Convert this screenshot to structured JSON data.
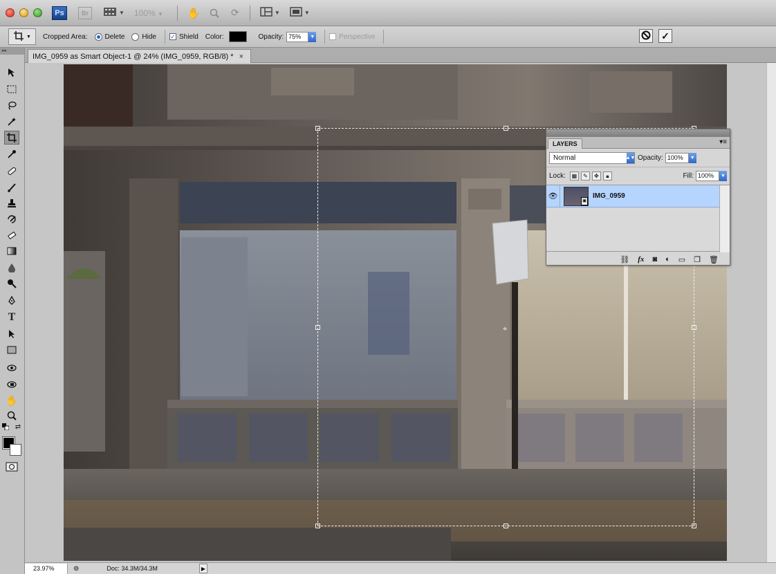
{
  "app": {
    "logo": "Ps",
    "bridge": "Br",
    "zoom": "100%"
  },
  "options": {
    "cropped_area_label": "Cropped Area:",
    "delete_label": "Delete",
    "hide_label": "Hide",
    "shield_label": "Shield",
    "color_label": "Color:",
    "opacity_label": "Opacity:",
    "opacity_value": "75%",
    "perspective_label": "Perspective",
    "shield_color": "#000000"
  },
  "document": {
    "tab_title": "IMG_0959 as Smart Object-1 @ 24% (IMG_0959, RGB/8) *",
    "close": "×"
  },
  "layers_panel": {
    "tab_label": "LAYERS",
    "blend_mode": "Normal",
    "opacity_label": "Opacity:",
    "opacity_value": "100%",
    "lock_label": "Lock:",
    "fill_label": "Fill:",
    "fill_value": "100%",
    "layers": [
      {
        "name": "IMG_0959",
        "visible": true,
        "selected": true
      }
    ]
  },
  "status": {
    "zoom": "23.97%",
    "doc_info": "Doc: 34.3M/34.3M"
  }
}
